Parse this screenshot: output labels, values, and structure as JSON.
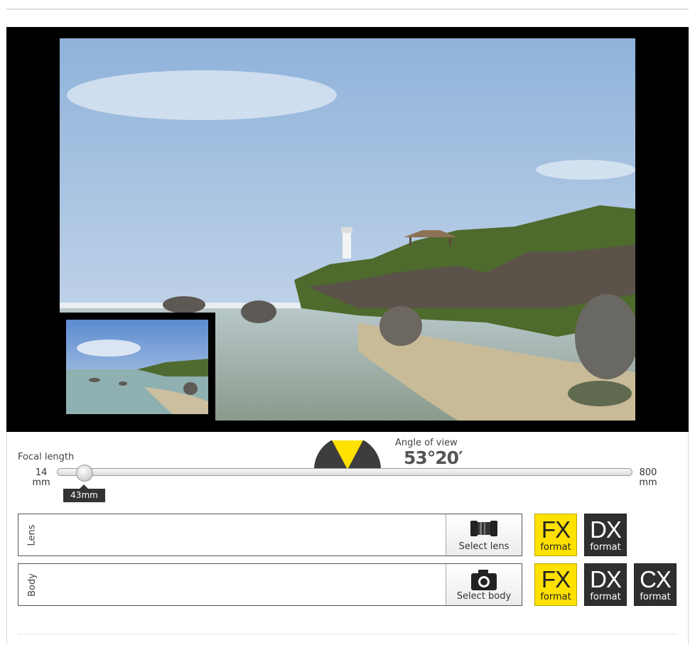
{
  "viewer": {
    "main_photo": "coastal-lighthouse-view",
    "thumbnail": "wide-angle-preview"
  },
  "focal_length": {
    "label": "Focal length",
    "min_value": "14",
    "min_unit": "mm",
    "max_value": "800",
    "max_unit": "mm",
    "current": "43mm",
    "current_mm": 43
  },
  "angle_of_view": {
    "label": "Angle of view",
    "value": "53°20′"
  },
  "lens": {
    "label": "Lens",
    "button_label": "Select lens",
    "icon": "lens-icon",
    "formats": [
      {
        "big": "FX",
        "small": "format",
        "active": true
      },
      {
        "big": "DX",
        "small": "format",
        "active": false
      }
    ]
  },
  "body": {
    "label": "Body",
    "button_label": "Select body",
    "icon": "camera-icon",
    "formats": [
      {
        "big": "FX",
        "small": "format",
        "active": true
      },
      {
        "big": "DX",
        "small": "format",
        "active": false
      },
      {
        "big": "CX",
        "small": "format",
        "active": false
      }
    ]
  },
  "colors": {
    "accent_yellow": "#ffe100",
    "dark": "#2f2f2f"
  }
}
